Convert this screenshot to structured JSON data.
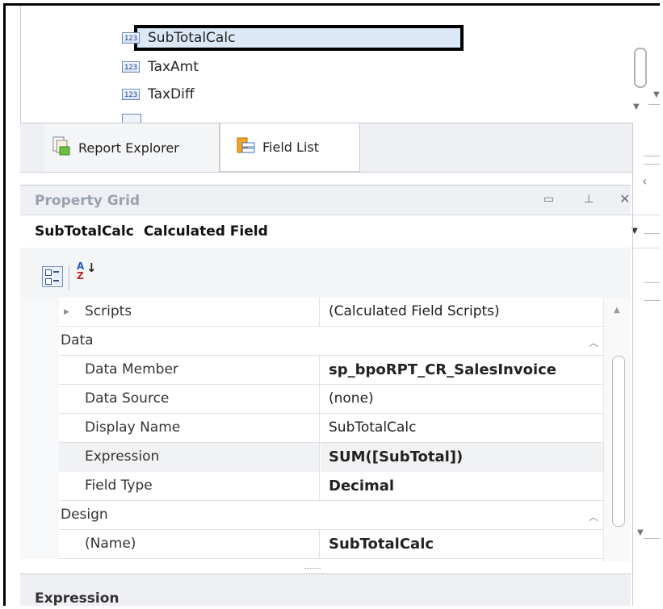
{
  "field_list": {
    "items": [
      {
        "icon": "123",
        "label": "SubTotalCalc"
      },
      {
        "icon": "123",
        "label": "TaxAmt"
      },
      {
        "icon": "123",
        "label": "TaxDiff"
      }
    ]
  },
  "tabs": [
    {
      "label": "Report Explorer",
      "icon": "report-explorer-icon"
    },
    {
      "label": "Field List",
      "icon": "field-list-icon"
    }
  ],
  "property_grid": {
    "title": "Property Grid",
    "object_name": "SubTotalCalc",
    "object_type": "Calculated Field",
    "toolbar": {
      "sort_az": "A↓Z",
      "az_top": "A",
      "az_bottom": "Z"
    },
    "rows": [
      {
        "kind": "prop",
        "name": "Scripts",
        "value": "(Calculated Field Scripts)",
        "bold": false,
        "expandable": true
      },
      {
        "kind": "category",
        "name": "Data"
      },
      {
        "kind": "prop",
        "name": "Data Member",
        "value": "sp_bpoRPT_CR_SalesInvoice",
        "bold": true
      },
      {
        "kind": "prop",
        "name": "Data Source",
        "value": "(none)",
        "bold": false
      },
      {
        "kind": "prop",
        "name": "Display Name",
        "value": "SubTotalCalc",
        "bold": false
      },
      {
        "kind": "prop",
        "name": "Expression",
        "value": "SUM([SubTotal])",
        "bold": true,
        "highlight": true
      },
      {
        "kind": "prop",
        "name": "Field Type",
        "value": "Decimal",
        "bold": true
      },
      {
        "kind": "category",
        "name": "Design"
      },
      {
        "kind": "prop",
        "name": "(Name)",
        "value": "SubTotalCalc",
        "bold": true
      }
    ]
  },
  "description": {
    "title": "Expression"
  },
  "icons": {
    "pin": "pin-icon",
    "restore": "restore-icon",
    "close": "close-icon",
    "categorized": "categorized-icon",
    "alphabetical": "alphabetical-sort-icon"
  },
  "colors": {
    "selection": "#dde8f7",
    "panel": "#eef0f3",
    "header_text": "#9aa2ad"
  }
}
